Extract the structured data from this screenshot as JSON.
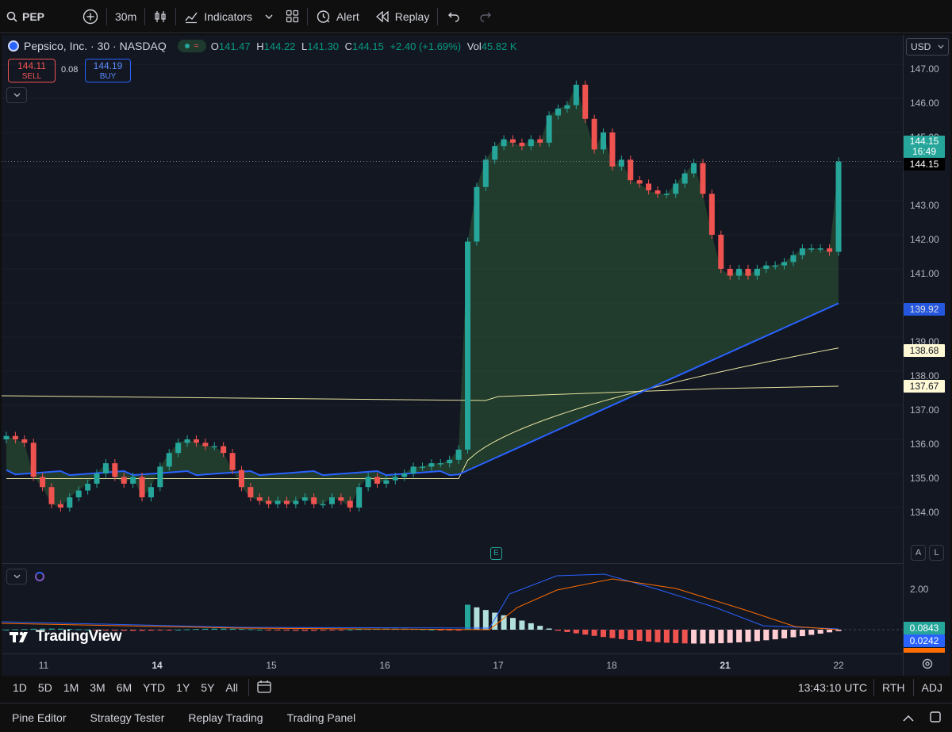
{
  "toolbar": {
    "symbol": "PEP",
    "interval": "30m",
    "indicators_label": "Indicators",
    "alert_label": "Alert",
    "replay_label": "Replay"
  },
  "legend": {
    "title": "Pepsico, Inc. · 30 · NASDAQ",
    "open_label": "O",
    "open": "141.47",
    "high_label": "H",
    "high": "144.22",
    "low_label": "L",
    "low": "141.30",
    "close_label": "C",
    "close": "144.15",
    "change": "+2.40 (+1.69%)",
    "vol_label": "Vol",
    "vol": "45.82 K"
  },
  "trade": {
    "sell_price": "144.11",
    "sell_label": "SELL",
    "spread": "0.08",
    "buy_price": "144.19",
    "buy_label": "BUY"
  },
  "currency": "USD",
  "price_ticks": [
    "147.00",
    "146.00",
    "145.00",
    "143.00",
    "142.00",
    "141.00",
    "139.00",
    "138.00",
    "137.00",
    "136.00",
    "135.00",
    "134.00"
  ],
  "price_tags": {
    "last": "144.15",
    "countdown": "16:49",
    "crosshair": "144.15",
    "ema_fast": "139.92",
    "ma_mid": "138.68",
    "ma_slow": "137.67"
  },
  "macd": {
    "tick": "2.00",
    "hist": "0.0843",
    "macd": "0.0242"
  },
  "scale_buttons": {
    "auto": "A",
    "log": "L"
  },
  "earnings_marker": "E",
  "time_ticks": [
    "11",
    "14",
    "15",
    "16",
    "17",
    "18",
    "21",
    "22"
  ],
  "watermark": "TradingView",
  "ranges": [
    "1D",
    "5D",
    "1M",
    "3M",
    "6M",
    "YTD",
    "1Y",
    "5Y",
    "All"
  ],
  "clock": "13:43:10 UTC",
  "session": "RTH",
  "adj": "ADJ",
  "bottom_tabs": [
    "Pine Editor",
    "Strategy Tester",
    "Replay Trading",
    "Trading Panel"
  ],
  "colors": {
    "up": "#26a69a",
    "down": "#ef5350",
    "ema": "#2962ff",
    "ma": "#e8e4a0",
    "macd_line": "#2962ff",
    "signal_line": "#ff6d00"
  }
}
